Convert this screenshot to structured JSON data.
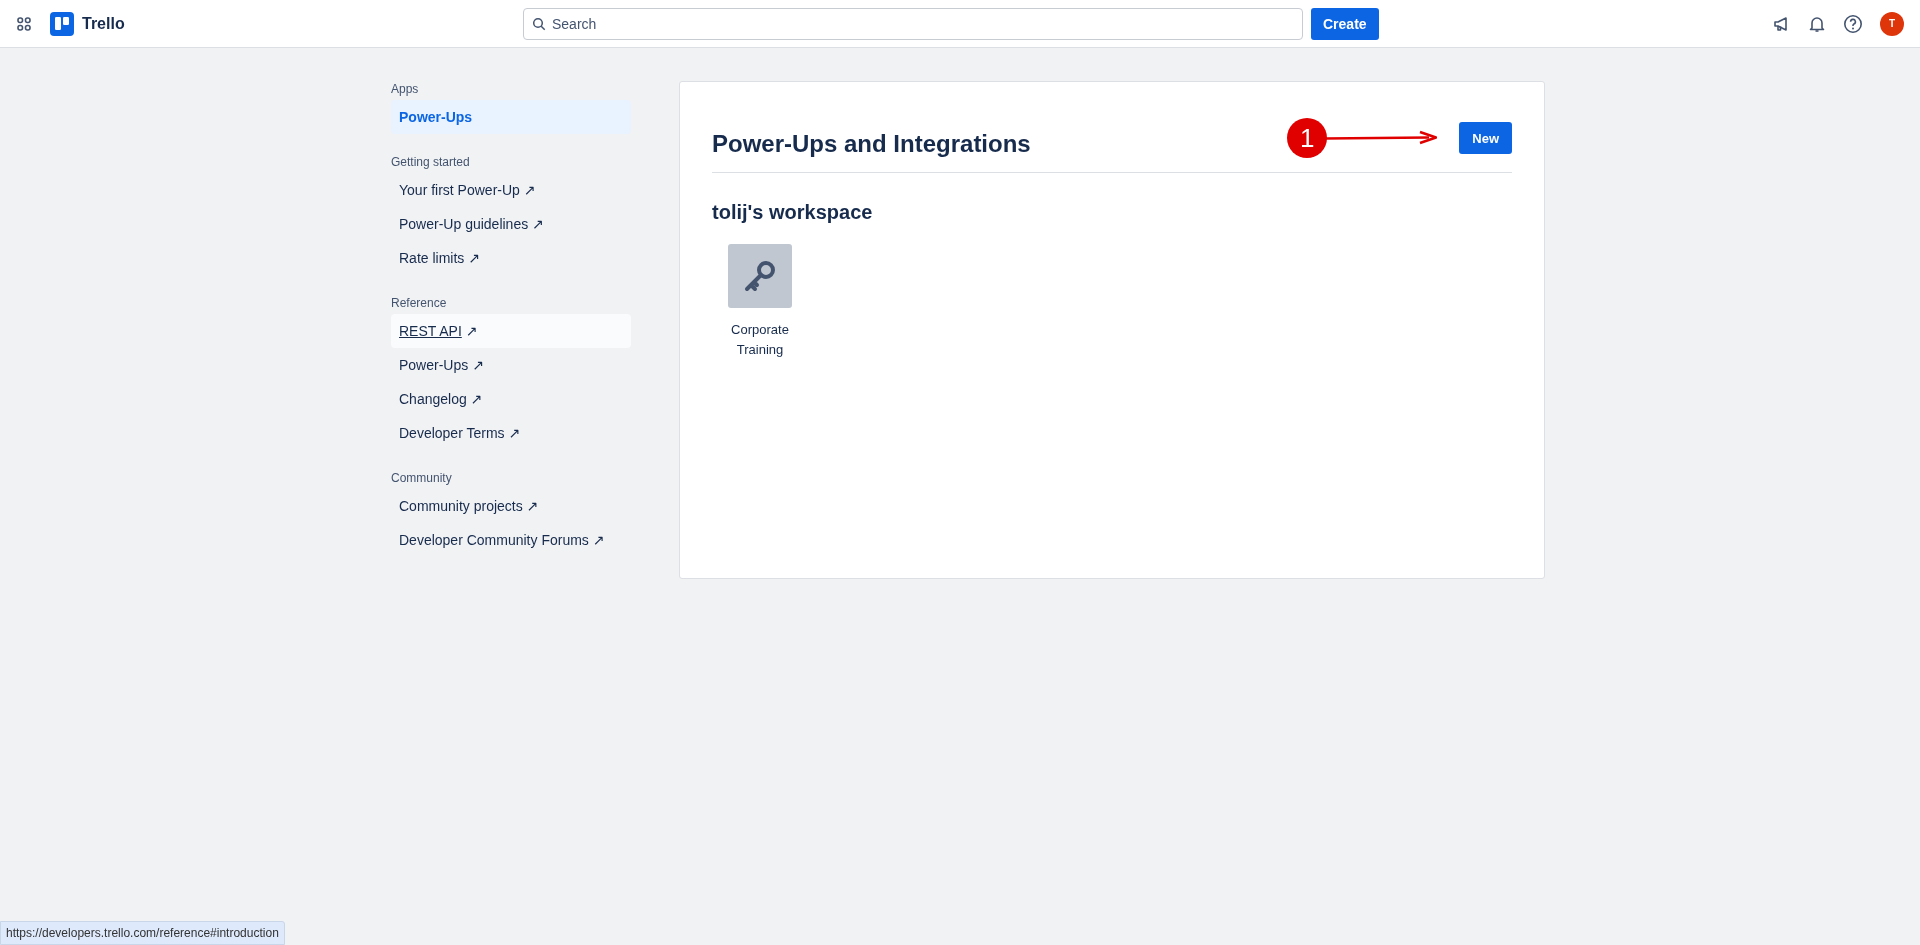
{
  "header": {
    "app_name": "Trello",
    "search": {
      "placeholder": "Search"
    },
    "create_button": "Create",
    "avatar": {
      "initial": "T",
      "color": "#de350b"
    }
  },
  "sidebar": {
    "sections": [
      {
        "title": "Apps",
        "items": [
          {
            "label": "Power-Ups",
            "selected": true,
            "hovered": false
          }
        ]
      },
      {
        "title": "Getting started",
        "items": [
          {
            "label": "Your first Power-Up ↗",
            "selected": false,
            "hovered": false
          },
          {
            "label": "Power-Up guidelines ↗",
            "selected": false,
            "hovered": false
          },
          {
            "label": "Rate limits ↗",
            "selected": false,
            "hovered": false
          }
        ]
      },
      {
        "title": "Reference",
        "items": [
          {
            "label": "REST API",
            "suffix": "↗",
            "selected": false,
            "hovered": true
          },
          {
            "label": "Power-Ups ↗",
            "selected": false,
            "hovered": false
          },
          {
            "label": "Changelog ↗",
            "selected": false,
            "hovered": false
          },
          {
            "label": "Developer Terms ↗",
            "selected": false,
            "hovered": false
          }
        ]
      },
      {
        "title": "Community",
        "items": [
          {
            "label": "Community projects ↗",
            "selected": false,
            "hovered": false
          },
          {
            "label": "Developer Community Forums ↗",
            "selected": false,
            "hovered": false
          }
        ]
      }
    ]
  },
  "main": {
    "title": "Power-Ups and Integrations",
    "new_button": "New",
    "annotation": {
      "number": "1"
    },
    "workspaces": [
      {
        "name": "tolij's workspace",
        "power_ups": [
          {
            "name": "Corporate Training"
          }
        ]
      }
    ]
  },
  "status_url": "https://developers.trello.com/reference#introduction"
}
